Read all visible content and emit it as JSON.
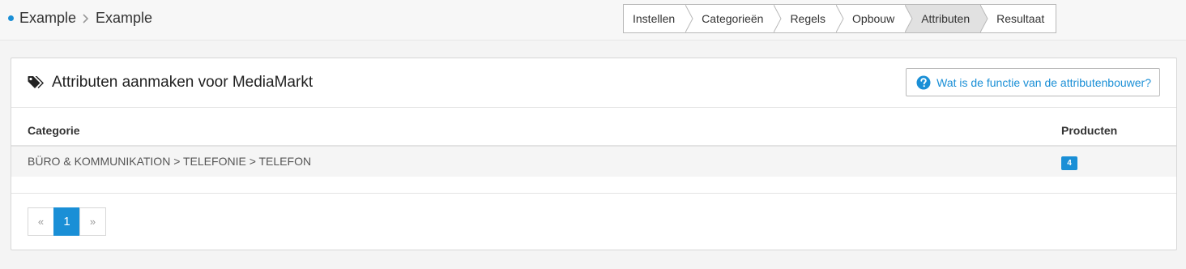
{
  "breadcrumb": {
    "items": [
      "Example",
      "Example"
    ]
  },
  "wizard": {
    "steps": [
      {
        "label": "Instellen",
        "active": false
      },
      {
        "label": "Categorieën",
        "active": false
      },
      {
        "label": "Regels",
        "active": false
      },
      {
        "label": "Opbouw",
        "active": false
      },
      {
        "label": "Attributen",
        "active": true
      },
      {
        "label": "Resultaat",
        "active": false
      }
    ]
  },
  "panel": {
    "title": "Attributen aanmaken voor MediaMarkt",
    "title_icon": "tags-icon",
    "help_button": "Wat is de functie van de attributenbouwer?",
    "help_icon": "question-circle-icon"
  },
  "table": {
    "columns": [
      "Categorie",
      "Producten"
    ],
    "rows": [
      {
        "category": "BÜRO & KOMMUNIKATION > TELEFONIE > TELEFON",
        "products": "4"
      }
    ]
  },
  "pagination": {
    "prev": "«",
    "current": "1",
    "next": "»"
  },
  "colors": {
    "accent": "#1a8fd6",
    "active_step": "#e1e1e1"
  }
}
